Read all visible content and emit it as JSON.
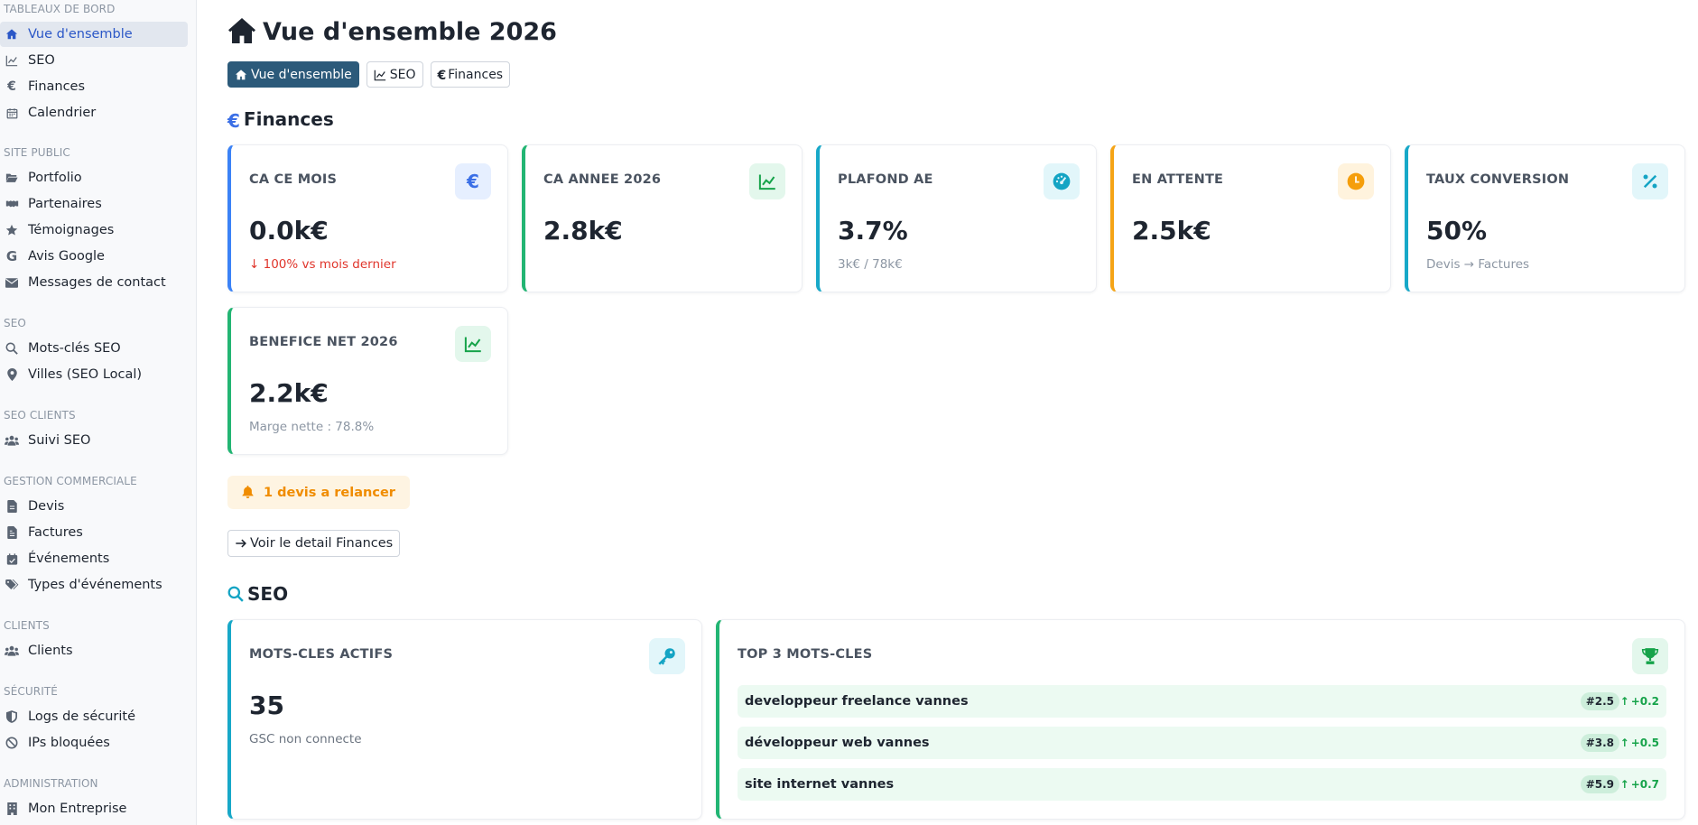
{
  "sidebar": {
    "sections": [
      {
        "title": "TABLEAUX DE BORD",
        "items": [
          {
            "label": "Vue d'ensemble",
            "icon": "home-icon",
            "active": true
          },
          {
            "label": "SEO",
            "icon": "chart-line-icon"
          },
          {
            "label": "Finances",
            "icon": "euro-icon"
          },
          {
            "label": "Calendrier",
            "icon": "calendar-icon"
          }
        ]
      },
      {
        "title": "SITE PUBLIC",
        "items": [
          {
            "label": "Portfolio",
            "icon": "folder-open-icon"
          },
          {
            "label": "Partenaires",
            "icon": "handshake-icon"
          },
          {
            "label": "Témoignages",
            "icon": "star-icon"
          },
          {
            "label": "Avis Google",
            "icon": "google-icon"
          },
          {
            "label": "Messages de contact",
            "icon": "envelope-icon"
          }
        ]
      },
      {
        "title": "SEO",
        "items": [
          {
            "label": "Mots-clés SEO",
            "icon": "search-icon"
          },
          {
            "label": "Villes (SEO Local)",
            "icon": "map-pin-icon"
          }
        ]
      },
      {
        "title": "SEO CLIENTS",
        "items": [
          {
            "label": "Suivi SEO",
            "icon": "users-icon"
          }
        ]
      },
      {
        "title": "GESTION COMMERCIALE",
        "items": [
          {
            "label": "Devis",
            "icon": "file-icon"
          },
          {
            "label": "Factures",
            "icon": "invoice-icon"
          },
          {
            "label": "Événements",
            "icon": "calendar-check-icon"
          },
          {
            "label": "Types d'événements",
            "icon": "tags-icon"
          }
        ]
      },
      {
        "title": "CLIENTS",
        "items": [
          {
            "label": "Clients",
            "icon": "users-icon"
          }
        ]
      },
      {
        "title": "SÉCURITÉ",
        "items": [
          {
            "label": "Logs de sécurité",
            "icon": "shield-icon"
          },
          {
            "label": "IPs bloquées",
            "icon": "ban-icon"
          }
        ]
      },
      {
        "title": "ADMINISTRATION",
        "items": [
          {
            "label": "Mon Entreprise",
            "icon": "building-icon"
          }
        ]
      }
    ]
  },
  "header": {
    "title": "Vue d'ensemble 2026",
    "tabs": [
      {
        "label": "Vue d'ensemble",
        "icon": "home-icon",
        "active": true
      },
      {
        "label": "SEO",
        "icon": "chart-line-icon"
      },
      {
        "label": "Finances",
        "icon": "euro-icon"
      }
    ]
  },
  "finances": {
    "title": "Finances",
    "cards": [
      {
        "label": "CA CE MOIS",
        "value": "0.0k€",
        "sub": "↓ 100% vs mois dernier",
        "sub_style": "red",
        "accent": "#3b82f6",
        "icon": "euro-icon",
        "icon_bg": "#e6efff",
        "icon_color": "#3b6fe6"
      },
      {
        "label": "CA ANNEE 2026",
        "value": "2.8k€",
        "sub": "",
        "accent": "#22b573",
        "icon": "chart-line-icon",
        "icon_bg": "#e3f7ec",
        "icon_color": "#16a34a"
      },
      {
        "label": "PLAFOND AE",
        "value": "3.7%",
        "sub": "3k€ / 78k€",
        "accent": "#17a8c8",
        "icon": "gauge-icon",
        "icon_bg": "#e2f6fa",
        "icon_color": "#14a4c4"
      },
      {
        "label": "EN ATTENTE",
        "value": "2.5k€",
        "sub": "",
        "accent": "#f5a416",
        "icon": "clock-icon",
        "icon_bg": "#fff3dd",
        "icon_color": "#f59e0b"
      },
      {
        "label": "TAUX CONVERSION",
        "value": "50%",
        "sub": "Devis → Factures",
        "accent": "#17a8c8",
        "icon": "percent-icon",
        "icon_bg": "#e2f6fa",
        "icon_color": "#14a4c4"
      },
      {
        "label": "BENEFICE NET 2026",
        "value": "2.2k€",
        "sub": "Marge nette : 78.8%",
        "accent": "#22b573",
        "icon": "chart-line-icon",
        "icon_bg": "#e3f7ec",
        "icon_color": "#16a34a"
      }
    ],
    "alert": "1 devis a relancer",
    "detail_button": "Voir le detail Finances"
  },
  "seo": {
    "title": "SEO",
    "keywords_card": {
      "label": "MOTS-CLES ACTIFS",
      "value": "35",
      "sub": "GSC non connecte",
      "accent": "#17a8c8",
      "icon": "key-icon",
      "icon_bg": "#e2f6fa",
      "icon_color": "#14a4c4"
    },
    "top_card": {
      "label": "TOP 3 MOTS-CLES",
      "accent": "#22b573",
      "icon": "trophy-icon",
      "icon_bg": "#e3f7ec",
      "icon_color": "#16a34a",
      "rows": [
        {
          "keyword": "developpeur freelance vannes",
          "rank": "#2.5",
          "delta": "+0.2"
        },
        {
          "keyword": "développeur web vannes",
          "rank": "#3.8",
          "delta": "+0.5"
        },
        {
          "keyword": "site internet vannes",
          "rank": "#5.9",
          "delta": "+0.7"
        }
      ]
    }
  }
}
